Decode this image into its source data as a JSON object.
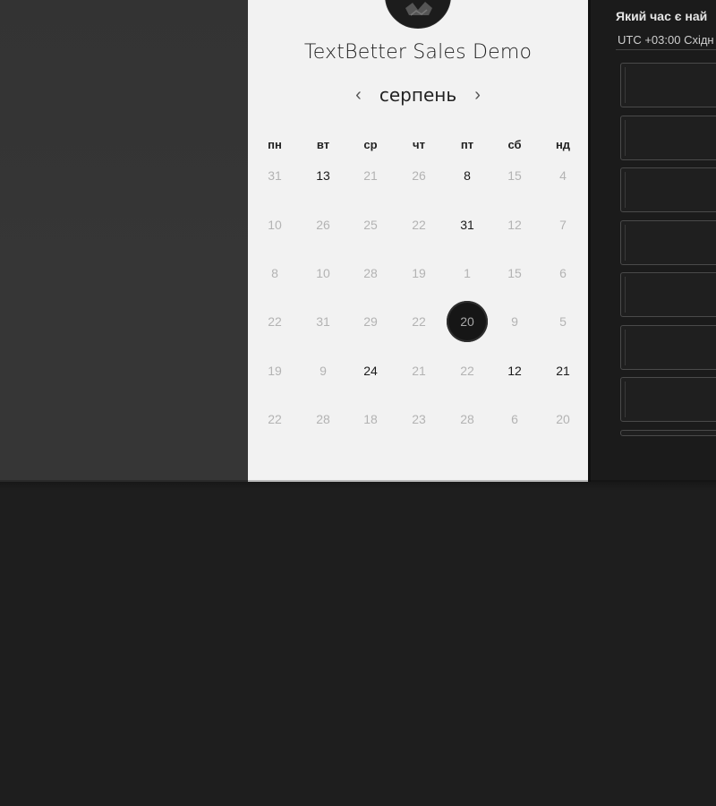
{
  "booking": {
    "title": "TextBetter Sales Demo",
    "month": "серпень",
    "prev_icon": "‹",
    "next_icon": "›",
    "weekdays": [
      "пн",
      "вт",
      "ср",
      "чт",
      "пт",
      "сб",
      "нд"
    ],
    "weeks": [
      [
        {
          "label": "31",
          "available": false
        },
        {
          "label": "13",
          "available": true
        },
        {
          "label": "21",
          "available": false
        },
        {
          "label": "26",
          "available": false
        },
        {
          "label": "8",
          "available": true
        },
        {
          "label": "15",
          "available": false
        },
        {
          "label": "4",
          "available": false
        }
      ],
      [
        {
          "label": "10",
          "available": false
        },
        {
          "label": "26",
          "available": false
        },
        {
          "label": "25",
          "available": false
        },
        {
          "label": "22",
          "available": false
        },
        {
          "label": "31",
          "available": true
        },
        {
          "label": "12",
          "available": false
        },
        {
          "label": "7",
          "available": false
        }
      ],
      [
        {
          "label": "8",
          "available": false
        },
        {
          "label": "10",
          "available": false
        },
        {
          "label": "28",
          "available": false
        },
        {
          "label": "19",
          "available": false
        },
        {
          "label": "1",
          "available": false
        },
        {
          "label": "15",
          "available": false
        },
        {
          "label": "6",
          "available": false
        }
      ],
      [
        {
          "label": "22",
          "available": false
        },
        {
          "label": "31",
          "available": false
        },
        {
          "label": "29",
          "available": false
        },
        {
          "label": "22",
          "available": false
        },
        {
          "label": "20",
          "available": true,
          "selected": true
        },
        {
          "label": "9",
          "available": false
        },
        {
          "label": "5",
          "available": false
        }
      ],
      [
        {
          "label": "19",
          "available": false
        },
        {
          "label": "9",
          "available": false
        },
        {
          "label": "24",
          "available": true
        },
        {
          "label": "21",
          "available": false
        },
        {
          "label": "22",
          "available": false
        },
        {
          "label": "12",
          "available": true
        },
        {
          "label": "21",
          "available": true
        }
      ],
      [
        {
          "label": "22",
          "available": false
        },
        {
          "label": "28",
          "available": false
        },
        {
          "label": "18",
          "available": false
        },
        {
          "label": "23",
          "available": false
        },
        {
          "label": "28",
          "available": false
        },
        {
          "label": "6",
          "available": false
        },
        {
          "label": "20",
          "available": false
        }
      ]
    ]
  },
  "time_panel": {
    "heading": "Який час є най",
    "timezone": "UTC +03:00 Східн",
    "slot_count": 8
  },
  "colors": {
    "background": "#1e1e1e",
    "card": "#f2f2f2",
    "selected_day": "#161616",
    "muted_day": "#b3b3b3",
    "available_day": "#1a1a1a"
  }
}
